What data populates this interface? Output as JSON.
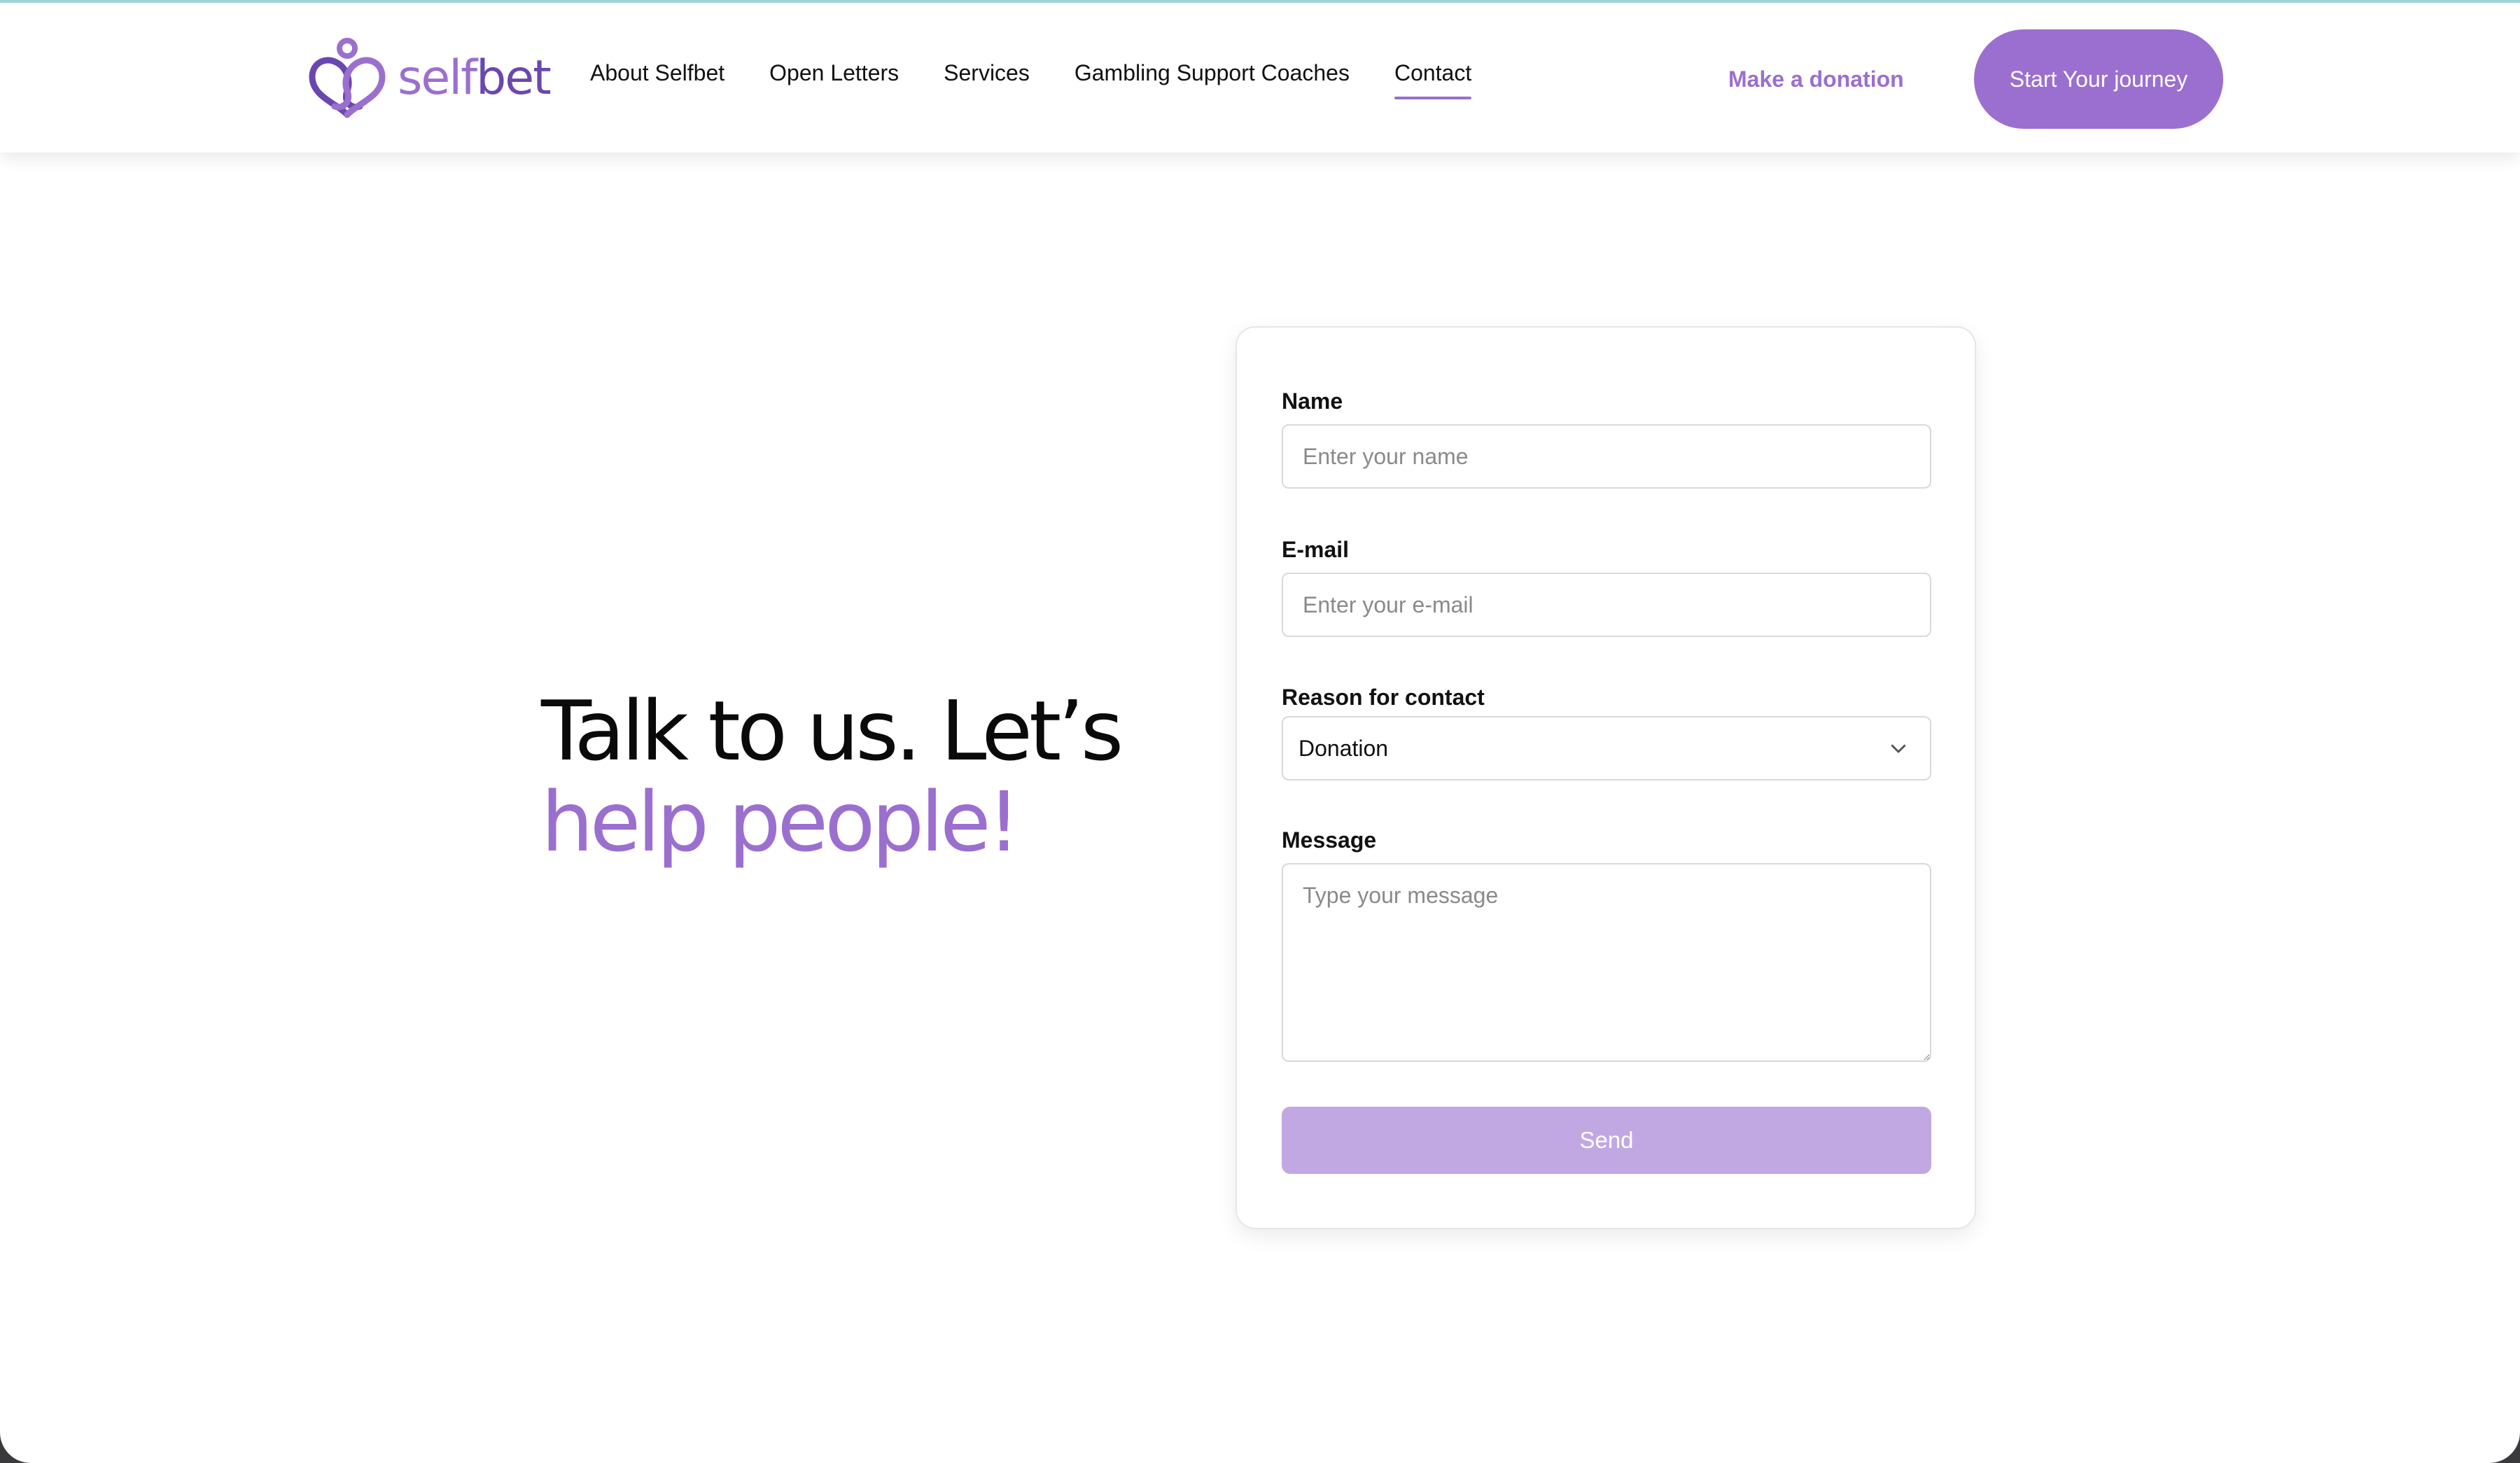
{
  "header": {
    "logo_text_self": "self",
    "logo_text_bet": "bet",
    "nav": [
      {
        "label": "About Selfbet"
      },
      {
        "label": "Open Letters"
      },
      {
        "label": "Services"
      },
      {
        "label": "Gambling Support Coaches"
      },
      {
        "label": "Contact",
        "active": true
      }
    ],
    "donate_label": "Make a donation",
    "journey_label": "Start Your journey"
  },
  "hero": {
    "line1": "Talk to us. Let’s",
    "line2": "help people!"
  },
  "form": {
    "name": {
      "label": "Name",
      "placeholder": "Enter your name",
      "value": ""
    },
    "email": {
      "label": "E-mail",
      "placeholder": "Enter your e-mail",
      "value": ""
    },
    "reason": {
      "label": "Reason for contact",
      "selected": "Donation"
    },
    "message": {
      "label": "Message",
      "placeholder": "Type your message",
      "value": ""
    },
    "send_label": "Send"
  },
  "colors": {
    "brand": "#9b6fcf",
    "brand_dark": "#6a47b0",
    "send_disabled": "#c2a8e3"
  },
  "icons": {
    "logo": "selfbet-heart-logo-icon",
    "select_arrow": "chevron-down-icon"
  }
}
